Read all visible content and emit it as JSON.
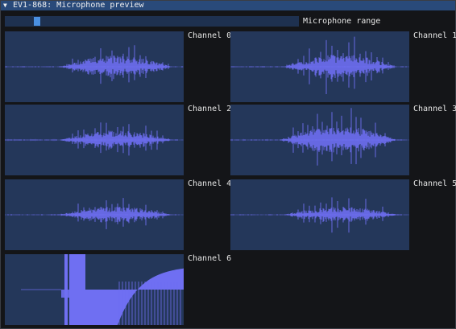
{
  "window": {
    "title": "EV1-868: Microphone preview",
    "collapse_icon": "triangle-down-icon"
  },
  "slider": {
    "label": "Microphone range",
    "value_fraction": 0.11
  },
  "colors": {
    "title_bar": "#294a7a",
    "plot_bg": "#24375a",
    "waveform": "#6f6ff2",
    "slider_track": "#1e3150",
    "slider_grab": "#4a90e2"
  },
  "channels": [
    {
      "label": "Channel 0"
    },
    {
      "label": "Channel 1"
    },
    {
      "label": "Channel 2"
    },
    {
      "label": "Channel 3"
    },
    {
      "label": "Channel 4"
    },
    {
      "label": "Channel 5"
    },
    {
      "label": "Channel 6"
    }
  ]
}
